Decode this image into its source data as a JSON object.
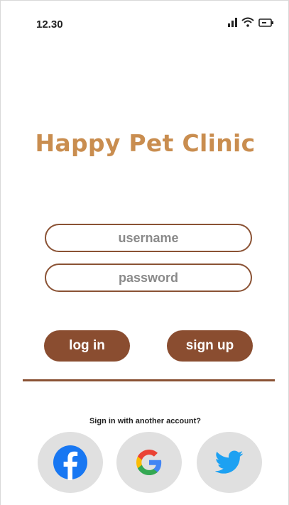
{
  "status_bar": {
    "time": "12.30",
    "icons": [
      "signal-icon",
      "wifi-icon",
      "battery-icon"
    ]
  },
  "app": {
    "title": "Happy Pet Clinic"
  },
  "login_form": {
    "username_placeholder": "username",
    "password_placeholder": "password",
    "login_label": "log in",
    "signup_label": "sign up"
  },
  "alternate_signin": {
    "prompt": "Sign in with another account?",
    "providers": [
      "facebook-icon",
      "google-icon",
      "twitter-icon"
    ]
  },
  "colors": {
    "title": "#c98d4f",
    "button": "#8a4d30",
    "outline": "#8a5234",
    "social_bg": "#e0e0e0",
    "facebook": "#1877f2",
    "twitter": "#1da1f2"
  }
}
